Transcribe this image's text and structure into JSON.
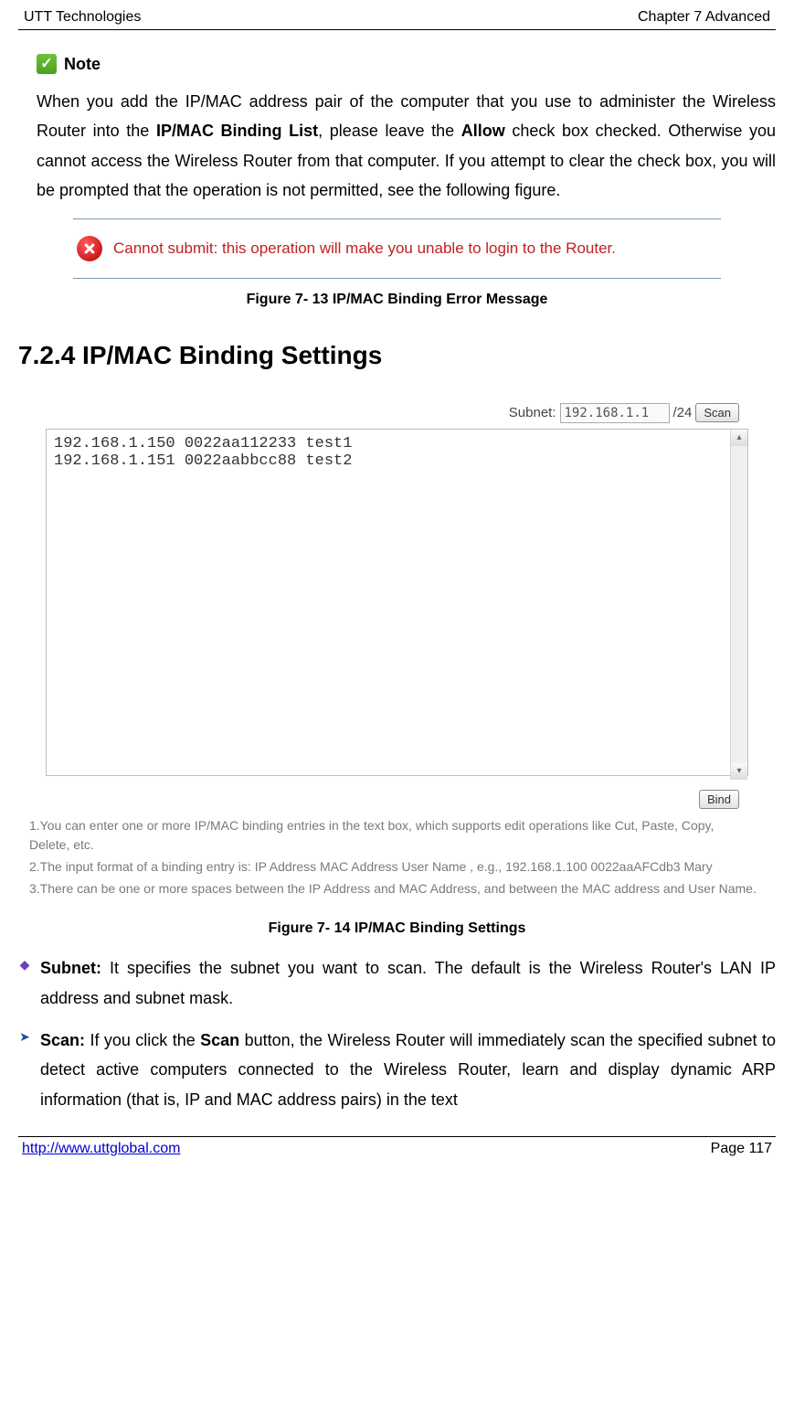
{
  "header": {
    "left": "UTT Technologies",
    "right": "Chapter 7 Advanced"
  },
  "note": {
    "label": "Note",
    "paragraph_parts": {
      "p1": "When you add the IP/MAC address pair of the computer that you use to administer the Wireless Router into the ",
      "b1": "IP/MAC Binding List",
      "p2": ", please leave the ",
      "b2": "Allow",
      "p3": " check box checked. Otherwise you cannot access the Wireless Router from that computer. If you attempt to clear the check box, you will be prompted that the operation is not permitted, see the following figure."
    }
  },
  "error_message": "Cannot submit: this operation will make you unable to login to the Router.",
  "figure13_caption": "Figure 7- 13 IP/MAC Binding Error Message",
  "section_heading": "7.2.4    IP/MAC Binding Settings",
  "scan": {
    "subnet_label": "Subnet:",
    "subnet_value": "192.168.1.1",
    "mask_label": "/24",
    "scan_button": "Scan"
  },
  "binding_textarea": "192.168.1.150 0022aa112233 test1\n192.168.1.151 0022aabbcc88 test2",
  "bind_button": "Bind",
  "help": {
    "h1": "1.You can enter one or more IP/MAC binding entries in the text box, which supports edit operations like Cut, Paste, Copy, Delete, etc.",
    "h2": "2.The input format of a binding entry is: IP Address MAC Address User Name , e.g., 192.168.1.100 0022aaAFCdb3 Mary",
    "h3": "3.There can be one or more spaces between the IP Address and MAC Address, and between the MAC address and User Name."
  },
  "figure14_caption": "Figure 7- 14 IP/MAC Binding Settings",
  "defs": {
    "subnet": {
      "label": "Subnet:",
      "text": " It specifies the subnet you want to scan. The default is the Wireless Router's LAN IP address and subnet mask."
    },
    "scan": {
      "label": "Scan:",
      "text_a": " If you click the ",
      "bold": "Scan",
      "text_b": " button, the Wireless Router will immediately scan the specified subnet to detect active computers connected to the Wireless Router, learn and display dynamic ARP information (that is, IP and MAC address pairs) in the text"
    }
  },
  "footer": {
    "link": "http://www.uttglobal.com",
    "page": "Page 117"
  }
}
